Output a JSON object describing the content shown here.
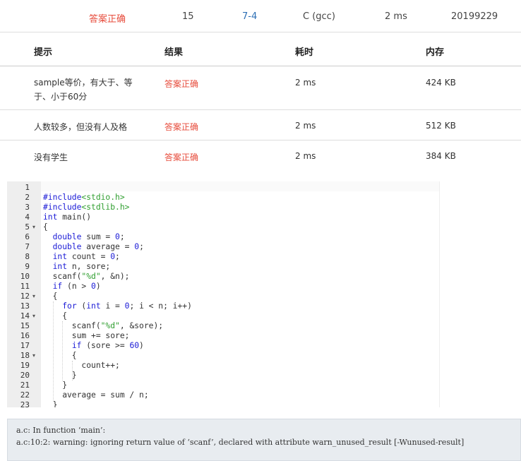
{
  "submission": {
    "status": "答案正确",
    "score": "15",
    "problem": "7-4",
    "compiler": "C (gcc)",
    "time": "2 ms",
    "user": "20199229"
  },
  "table": {
    "headers": [
      "提示",
      "结果",
      "耗时",
      "内存"
    ],
    "rows": [
      {
        "hint": "sample等价，有大于、等于、小于60分",
        "result": "答案正确",
        "time": "2 ms",
        "memory": "424 KB"
      },
      {
        "hint": "人数较多，但没有人及格",
        "result": "答案正确",
        "time": "2 ms",
        "memory": "512 KB"
      },
      {
        "hint": "没有学生",
        "result": "答案正确",
        "time": "2 ms",
        "memory": "384 KB"
      }
    ]
  },
  "code_lines": [
    "",
    "#include<stdio.h>",
    "#include<stdlib.h>",
    "int main()",
    "{",
    "  double sum = 0;",
    "  double average = 0;",
    "  int count = 0;",
    "  int n, sore;",
    "  scanf(\"%d\", &n);",
    "  if (n > 0)",
    "  {",
    "    for (int i = 0; i < n; i++)",
    "    {",
    "      scanf(\"%d\", &sore);",
    "      sum += sore;",
    "      if (sore >= 60)",
    "      {",
    "        count++;",
    "      }",
    "    }",
    "    average = sum / n;",
    "  }"
  ],
  "line_numbers": [
    "1",
    "2",
    "3",
    "4",
    "5",
    "6",
    "7",
    "8",
    "9",
    "10",
    "11",
    "12",
    "13",
    "14",
    "15",
    "16",
    "17",
    "18",
    "19",
    "20",
    "21",
    "22",
    "23"
  ],
  "fold_lines": [
    5,
    12,
    14,
    18
  ],
  "compiler_output": [
    "a.c: In function ‘main’:",
    "a.c:10:2: warning: ignoring return value of ‘scanf’, declared with attribute warn_unused_result [-Wunused-result]"
  ]
}
